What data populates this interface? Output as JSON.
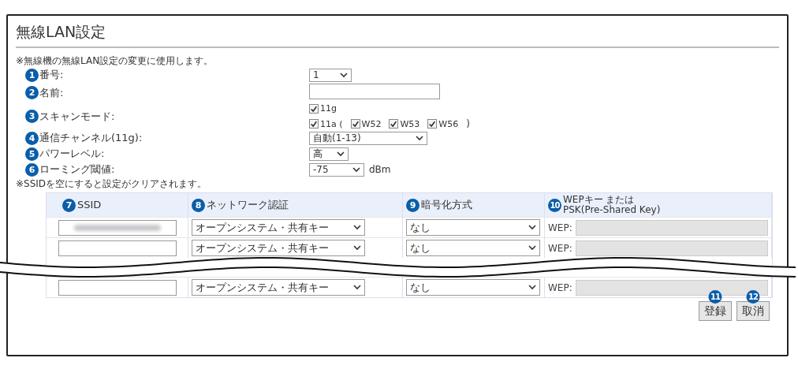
{
  "title": "無線LAN設定",
  "note": "※無線機の無線LAN設定の変更に使用します。",
  "fields": [
    {
      "badge": "1",
      "label": "番号:",
      "kind": "select",
      "value": "1"
    },
    {
      "badge": "2",
      "label": "名前:",
      "kind": "text"
    },
    {
      "badge": "3",
      "label": "スキャンモード:",
      "kind": "checks",
      "lines": [
        {
          "checks": [
            {
              "label": "11g",
              "checked": true
            }
          ]
        },
        {
          "checks": [
            {
              "label": "11a (",
              "checked": true
            },
            {
              "label": "W52",
              "checked": true
            },
            {
              "label": "W53",
              "checked": true
            },
            {
              "label": "W56",
              "checked": true
            }
          ],
          "suffix": ")"
        }
      ]
    },
    {
      "badge": "4",
      "label": "通信チャンネル(11g):",
      "kind": "select",
      "value": "自動(1-13)"
    },
    {
      "badge": "5",
      "label": "パワーレベル:",
      "kind": "select",
      "value": "高"
    },
    {
      "badge": "6",
      "label": "ローミング閾値:",
      "kind": "select",
      "value": "-75",
      "unit": "dBm"
    }
  ],
  "table_note": "※SSIDを空にすると設定がクリアされます。",
  "table": {
    "columns": [
      {
        "badge": "7",
        "label": "SSID"
      },
      {
        "badge": "8",
        "label": "ネットワーク認証"
      },
      {
        "badge": "9",
        "label": "暗号化方式"
      },
      {
        "badge": "10",
        "label": "WEPキー または\nPSK(Pre-Shared Key)"
      }
    ],
    "rows": [
      {
        "ssid_blurred": true,
        "auth": "オープンシステム・共有キー",
        "encryption": "なし",
        "key_label": "WEP:",
        "key_disabled": true
      },
      {
        "ssid_blurred": false,
        "auth": "オープンシステム・共有キー",
        "encryption": "なし",
        "key_label": "WEP:",
        "key_disabled": true
      },
      {
        "ssid_blurred": false,
        "auth": "オープンシステム・共有キー",
        "encryption": "なし",
        "key_label": "WEP:",
        "key_disabled": true
      }
    ]
  },
  "buttons": [
    {
      "badge": "11",
      "label": "登録"
    },
    {
      "badge": "12",
      "label": "取消"
    }
  ]
}
